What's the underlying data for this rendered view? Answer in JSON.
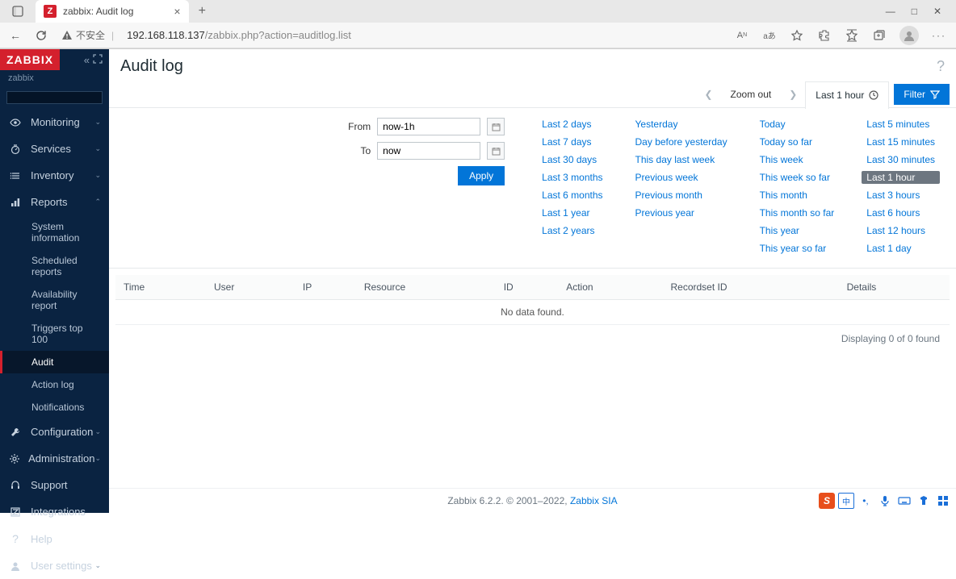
{
  "browser": {
    "tab_title": "zabbix: Audit log",
    "tab_favicon_letter": "Z",
    "security_text": "不安全",
    "url_host": "192.168.118.137",
    "url_path": "/zabbix.php?action=auditlog.list",
    "addr_font_label": "A",
    "addr_translate_label": "aあ"
  },
  "sidebar": {
    "logo": "ZABBIX",
    "tenant": "zabbix",
    "nav": {
      "monitoring": "Monitoring",
      "services": "Services",
      "inventory": "Inventory",
      "reports": "Reports",
      "configuration": "Configuration",
      "administration": "Administration"
    },
    "reports_sub": {
      "system_info": "System information",
      "scheduled": "Scheduled reports",
      "availability": "Availability report",
      "triggers": "Triggers top 100",
      "audit": "Audit",
      "action_log": "Action log",
      "notifications": "Notifications"
    },
    "bottom": {
      "support": "Support",
      "integrations": "Integrations",
      "help": "Help",
      "user_settings": "User settings"
    }
  },
  "page": {
    "title": "Audit log",
    "zoom_out": "Zoom out",
    "time_tab": "Last 1 hour",
    "filter_btn": "Filter"
  },
  "filter": {
    "from_label": "From",
    "to_label": "To",
    "from_value": "now-1h",
    "to_value": "now",
    "apply": "Apply"
  },
  "presets": {
    "col1": [
      "Last 2 days",
      "Last 7 days",
      "Last 30 days",
      "Last 3 months",
      "Last 6 months",
      "Last 1 year",
      "Last 2 years"
    ],
    "col2": [
      "Yesterday",
      "Day before yesterday",
      "This day last week",
      "Previous week",
      "Previous month",
      "Previous year"
    ],
    "col3": [
      "Today",
      "Today so far",
      "This week",
      "This week so far",
      "This month",
      "This month so far",
      "This year",
      "This year so far"
    ],
    "col4": [
      "Last 5 minutes",
      "Last 15 minutes",
      "Last 30 minutes",
      "Last 1 hour",
      "Last 3 hours",
      "Last 6 hours",
      "Last 12 hours",
      "Last 1 day"
    ],
    "active": "Last 1 hour"
  },
  "table": {
    "headers": [
      "Time",
      "User",
      "IP",
      "Resource",
      "ID",
      "Action",
      "Recordset ID",
      "Details"
    ],
    "no_data": "No data found.",
    "count_text": "Displaying 0 of 0 found"
  },
  "footer": {
    "text_a": "Zabbix 6.2.2. © 2001–2022, ",
    "link": "Zabbix SIA"
  },
  "ime": {
    "s": "S",
    "cn": "中"
  }
}
